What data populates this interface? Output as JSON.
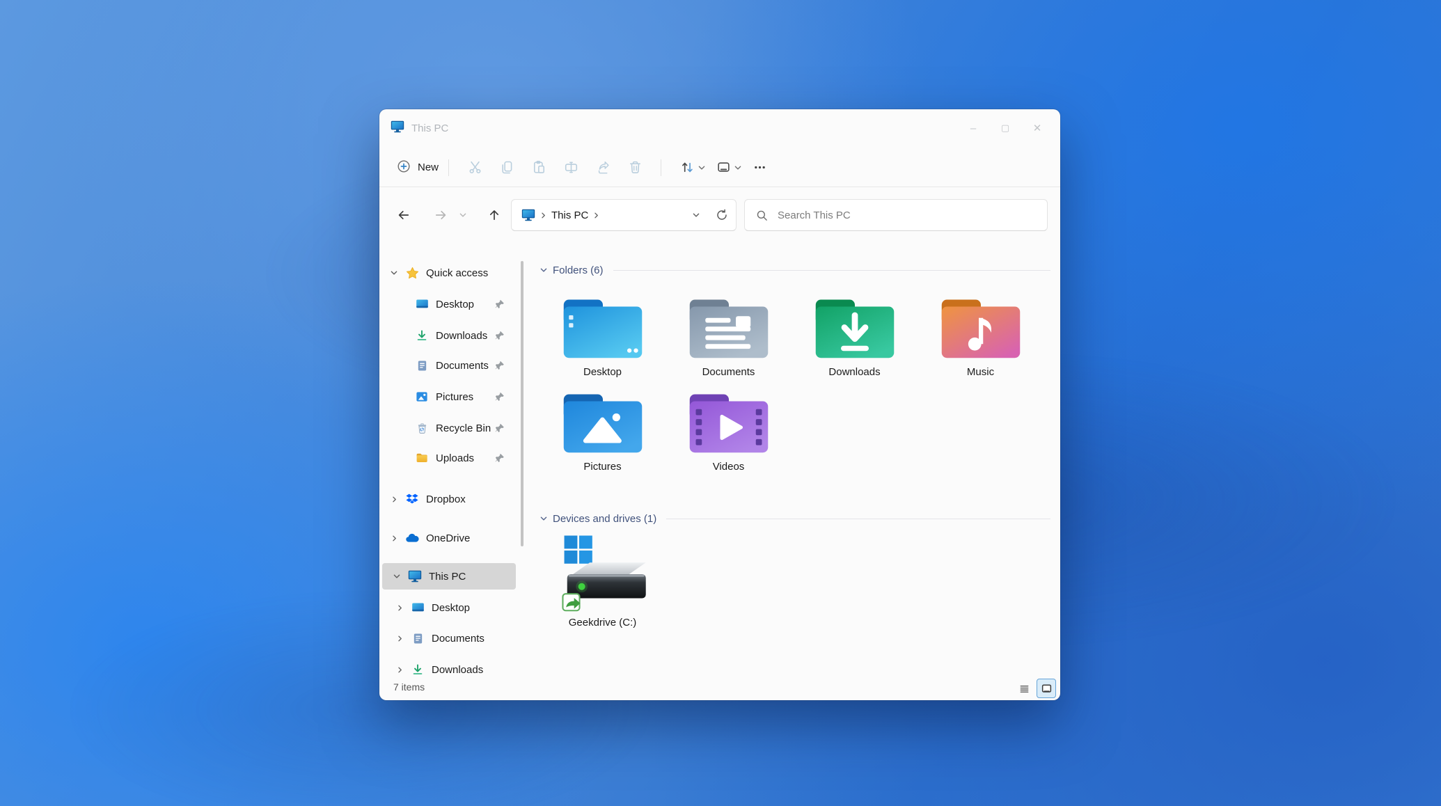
{
  "window": {
    "title": "This PC",
    "titlebar_controls": [
      {
        "name": "minimize",
        "glyph": "–"
      },
      {
        "name": "maximize",
        "glyph": "▢"
      },
      {
        "name": "close",
        "glyph": "✕"
      }
    ],
    "toolbar": {
      "new_button": {
        "label": "New",
        "icon": "plus-circle-icon"
      },
      "edit_tools": [
        {
          "name": "cut",
          "icon": "cut-icon",
          "enabled": false
        },
        {
          "name": "copy",
          "icon": "copy-icon",
          "enabled": false
        },
        {
          "name": "paste",
          "icon": "paste-icon",
          "enabled": false
        },
        {
          "name": "rename",
          "icon": "rename-icon",
          "enabled": false
        },
        {
          "name": "share",
          "icon": "share-icon",
          "enabled": false
        },
        {
          "name": "delete",
          "icon": "delete-icon",
          "enabled": false
        }
      ],
      "view_tools": [
        {
          "name": "sort",
          "icon": "sort-icon",
          "has_dropdown": true
        },
        {
          "name": "view",
          "icon": "view-icon",
          "has_dropdown": true
        },
        {
          "name": "more",
          "icon": "more-icon",
          "has_dropdown": false
        }
      ]
    },
    "navbar": {
      "buttons": [
        {
          "name": "back",
          "icon": "arrow-left-icon",
          "enabled": true
        },
        {
          "name": "forward",
          "icon": "arrow-right-icon",
          "enabled": false
        },
        {
          "name": "recent-locations",
          "icon": "chevron-down-icon",
          "enabled": false
        },
        {
          "name": "up",
          "icon": "arrow-up-icon",
          "enabled": true
        }
      ],
      "breadcrumb": {
        "icon": "computer-icon",
        "path": "This PC"
      },
      "search": {
        "placeholder": "Search This PC",
        "icon": "search-icon"
      }
    },
    "sidebar": {
      "items": [
        {
          "label": "Quick access",
          "icon": "star-icon",
          "chevron": "down",
          "level": 0
        },
        {
          "label": "Desktop",
          "icon": "desktop-icon",
          "pinned": true,
          "level": 1
        },
        {
          "label": "Downloads",
          "icon": "download-icon",
          "pinned": true,
          "level": 1
        },
        {
          "label": "Documents",
          "icon": "document-icon",
          "pinned": true,
          "level": 1
        },
        {
          "label": "Pictures",
          "icon": "pictures-icon",
          "pinned": true,
          "level": 1
        },
        {
          "label": "Recycle Bin",
          "icon": "recycle-bin-icon",
          "pinned": true,
          "level": 1
        },
        {
          "label": "Uploads",
          "icon": "folder-icon",
          "pinned": true,
          "level": 1
        },
        {
          "label": "Dropbox",
          "icon": "dropbox-icon",
          "chevron": "right",
          "level": 0
        },
        {
          "label": "OneDrive",
          "icon": "onedrive-icon",
          "chevron": "right",
          "level": 0
        },
        {
          "label": "This PC",
          "icon": "computer-icon",
          "chevron": "down",
          "level": 0,
          "selected": true
        },
        {
          "label": "Desktop",
          "icon": "desktop-icon",
          "chevron": "right",
          "level": 1
        },
        {
          "label": "Documents",
          "icon": "document-icon",
          "chevron": "right",
          "level": 1
        },
        {
          "label": "Downloads",
          "icon": "download-icon",
          "chevron": "right",
          "level": 1
        }
      ]
    },
    "content": {
      "sections": [
        {
          "title": "Folders",
          "count": 6,
          "items": [
            {
              "label": "Desktop",
              "icon": "folder-desktop-icon"
            },
            {
              "label": "Documents",
              "icon": "folder-documents-icon"
            },
            {
              "label": "Downloads",
              "icon": "folder-downloads-icon"
            },
            {
              "label": "Music",
              "icon": "folder-music-icon"
            },
            {
              "label": "Pictures",
              "icon": "folder-pictures-icon"
            },
            {
              "label": "Videos",
              "icon": "folder-videos-icon"
            }
          ]
        },
        {
          "title": "Devices and drives",
          "count": 1,
          "items": [
            {
              "label": "Geekdrive (C:)",
              "icon": "drive-windows-icon"
            }
          ]
        }
      ]
    },
    "statusbar": {
      "items_text": "7 items",
      "view_toggles": [
        {
          "name": "details-view",
          "icon": "list-view-icon",
          "active": false
        },
        {
          "name": "icons-view",
          "icon": "large-icons-view-icon",
          "active": true
        }
      ]
    }
  },
  "colors": {
    "accent_blue": "#1f8ad8",
    "selection_bg": "#d6d6d6",
    "section_header_text": "#41527c",
    "disabled_tool_icon": "#b9cedd",
    "folder_desktop": "#2ea2e4",
    "folder_documents": "#9aabbd",
    "folder_downloads": "#19a873",
    "folder_music": "#e88a4a",
    "folder_pictures": "#2a8ce4",
    "folder_videos": "#a06ae0",
    "drive_led_green": "#3fd23f",
    "windows_logo_blue": "#1f8ad8",
    "dropbox_blue": "#0062ff",
    "onedrive_blue": "#0a6ed1",
    "quick_access_star": "#f6c33d",
    "wallpaper_blues": [
      "#5c99e0",
      "#4787d8",
      "#2f74d0"
    ]
  }
}
